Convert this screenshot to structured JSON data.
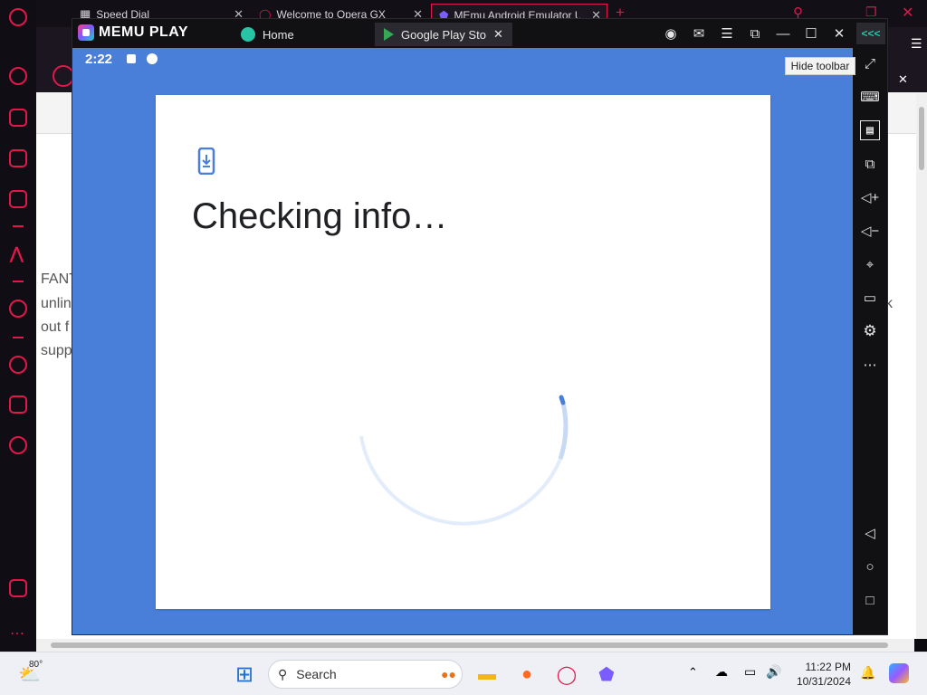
{
  "opera_tabs": [
    {
      "label": "Speed Dial",
      "icon": "grid-icon"
    },
    {
      "label": "Welcome to Opera GX",
      "icon": "opera-icon"
    },
    {
      "label": "MEmu Android Emulator U",
      "icon": "memu-icon"
    }
  ],
  "page_behind": {
    "lines": [
      "FANT",
      "unlin",
      "out f",
      "supp"
    ],
    "right_fragment": "k"
  },
  "memu": {
    "logo_text": "MEMU PLAY",
    "tabs": [
      {
        "label": "Home",
        "icon": "home-icon"
      },
      {
        "label": "Google Play Store",
        "icon": "play-store-icon"
      }
    ],
    "collapse_glyph": "<<<"
  },
  "android": {
    "status_time": "2:22",
    "dialog_title": "Checking info…",
    "background_color": "#4a7fd9",
    "dialog_icon": "phone-download-icon"
  },
  "tooltip": "Hide toolbar",
  "side_toolbar": [
    "fullscreen-icon",
    "keyboard-icon",
    "apk-icon",
    "multi-instance-icon",
    "volume-up-icon",
    "volume-down-icon",
    "location-icon",
    "folder-icon",
    "settings-icon",
    "more-icon",
    "back-icon",
    "home-circle-icon",
    "recents-icon"
  ],
  "taskbar": {
    "weather_temp": "80°",
    "search_placeholder": "Search",
    "time": "11:22 PM",
    "date": "10/31/2024"
  },
  "colors": {
    "opera_accent": "#e2174a",
    "progress": "#4a7fd9"
  }
}
